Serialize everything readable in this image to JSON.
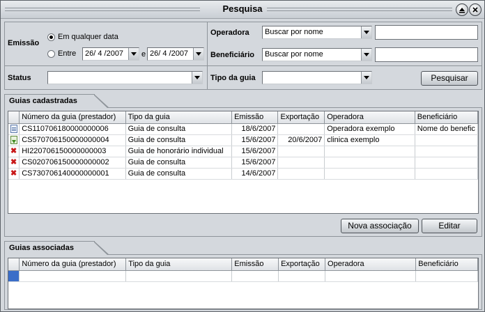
{
  "window": {
    "title": "Pesquisa",
    "collapse_icon": "collapse-up-icon",
    "close_icon": "close-icon"
  },
  "search": {
    "emissao_label": "Emissão",
    "radio_any_label": "Em qualquer data",
    "radio_range_label": "Entre",
    "date_from": "26/ 4 /2007",
    "date_and": "e",
    "date_to": "26/ 4 /2007",
    "status_label": "Status",
    "status_value": "",
    "operadora_label": "Operadora",
    "operadora_mode": "Buscar por nome",
    "operadora_text": "",
    "beneficiario_label": "Beneficiário",
    "beneficiario_mode": "Buscar por nome",
    "beneficiario_text": "",
    "tipo_guia_label": "Tipo da guia",
    "tipo_guia_value": "",
    "search_button": "Pesquisar"
  },
  "registered": {
    "tab_label": "Guias cadastradas",
    "columns": [
      "Número da guia (prestador)",
      "Tipo da guia",
      "Emissão",
      "Exportação",
      "Operadora",
      "Beneficiário"
    ],
    "rows": [
      {
        "icon": "document-icon",
        "numero": "CS110706180000000006",
        "tipo": "Guia de consulta",
        "emissao": "18/6/2007",
        "exportacao": "",
        "operadora": "Operadora exemplo",
        "beneficiario": "Nome do benefic"
      },
      {
        "icon": "exported-icon",
        "numero": "CS570706150000000004",
        "tipo": "Guia de consulta",
        "emissao": "15/6/2007",
        "exportacao": "20/6/2007",
        "operadora": "clinica exemplo",
        "beneficiario": ""
      },
      {
        "icon": "error-x-icon",
        "numero": "HI220706150000000003",
        "tipo": "Guia de honorário individual",
        "emissao": "15/6/2007",
        "exportacao": "",
        "operadora": "",
        "beneficiario": ""
      },
      {
        "icon": "error-x-icon",
        "numero": "CS020706150000000002",
        "tipo": "Guia de consulta",
        "emissao": "15/6/2007",
        "exportacao": "",
        "operadora": "",
        "beneficiario": ""
      },
      {
        "icon": "error-x-icon",
        "numero": "CS730706140000000001",
        "tipo": "Guia de consulta",
        "emissao": "14/6/2007",
        "exportacao": "",
        "operadora": "",
        "beneficiario": ""
      }
    ],
    "new_association_button": "Nova associação",
    "edit_button": "Editar"
  },
  "associated": {
    "tab_label": "Guias associadas",
    "columns": [
      "Número da guia (prestador)",
      "Tipo da guia",
      "Emissão",
      "Exportação",
      "Operadora",
      "Beneficiário"
    ]
  },
  "colors": {
    "window_bg": "#d4d8dd",
    "selection": "#3b6ec8",
    "error": "#c81818"
  }
}
